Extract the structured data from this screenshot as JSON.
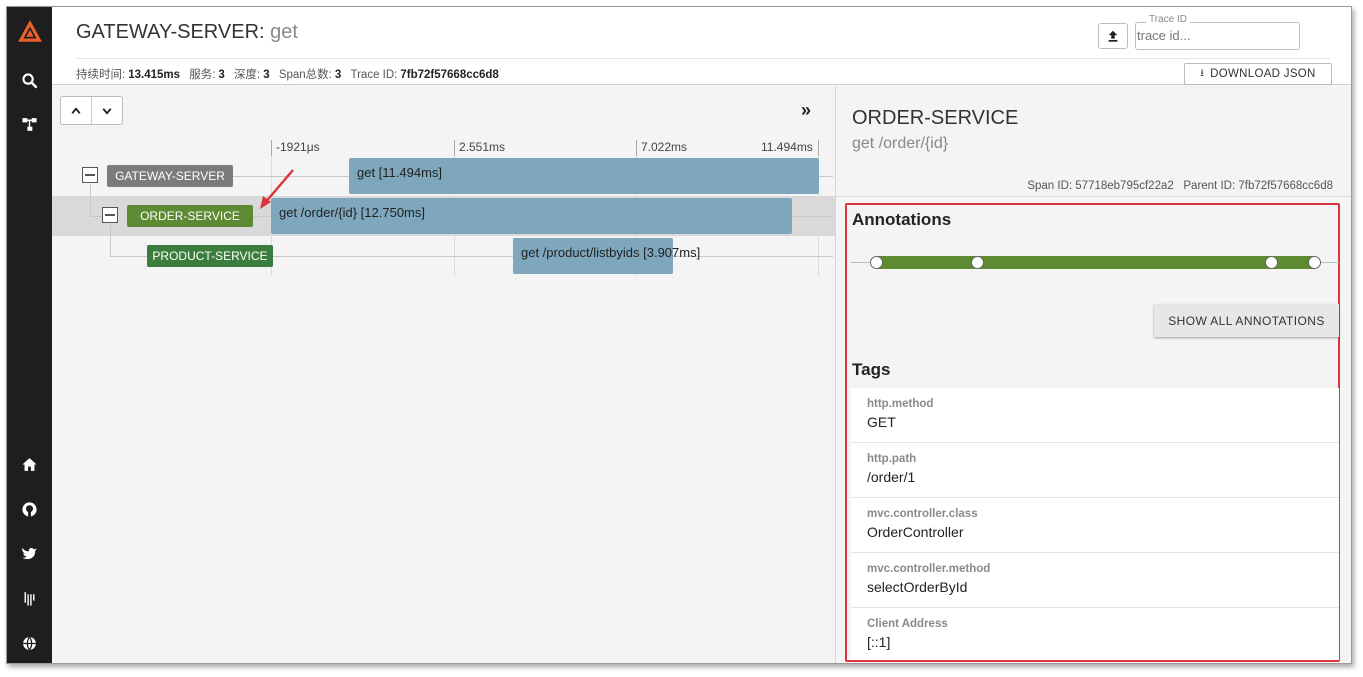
{
  "header": {
    "service": "GATEWAY-SERVER:",
    "span_name": " get",
    "stats": [
      {
        "label": "持续时间:",
        "value": "13.415ms"
      },
      {
        "label": "服务:",
        "value": "3"
      },
      {
        "label": "深度:",
        "value": "3"
      },
      {
        "label": "Span总数:",
        "value": "3"
      },
      {
        "label": "Trace ID:",
        "value": "7fb72f57668cc6d8"
      }
    ],
    "trace_id_label": "Trace ID",
    "trace_id_placeholder": "trace id...",
    "download_label": "DOWNLOAD JSON",
    "upload_icon": "upload-icon",
    "download_icon": "download-icon"
  },
  "sidebar": {
    "top_icons": [
      "logo-icon",
      "search-icon",
      "dependencies-icon"
    ],
    "bottom_icons": [
      "home-icon",
      "github-icon",
      "twitter-icon",
      "gitter-icon",
      "globe-icon"
    ]
  },
  "timeline": {
    "ticks": [
      "-1921μs",
      "2.551ms",
      "7.022ms",
      "11.494ms"
    ],
    "rows": [
      {
        "service": "GATEWAY-SERVER",
        "span": "get [11.494ms]",
        "color": "#7b7b7b"
      },
      {
        "service": "ORDER-SERVICE",
        "span": "get /order/{id} [12.750ms]",
        "color": "#5d8a32"
      },
      {
        "service": "PRODUCT-SERVICE",
        "span": "get /product/listbyids [3.907ms]",
        "color": "#3a7d3d"
      }
    ]
  },
  "detail": {
    "service": "ORDER-SERVICE",
    "span_name": "get /order/{id}",
    "span_id_label": "Span ID:",
    "span_id": "57718eb795cf22a2",
    "parent_id_label": "Parent ID:",
    "parent_id": "7fb72f57668cc6d8",
    "annotations_title": "Annotations",
    "show_all_label": "SHOW ALL ANNOTATIONS",
    "tags_title": "Tags",
    "tags": [
      {
        "key": "http.method",
        "value": "GET"
      },
      {
        "key": "http.path",
        "value": "/order/1"
      },
      {
        "key": "mvc.controller.class",
        "value": "OrderController"
      },
      {
        "key": "mvc.controller.method",
        "value": "selectOrderById"
      },
      {
        "key": "Client Address",
        "value": "[::1]"
      }
    ]
  },
  "colors": {
    "sidebar": "#1e1e1e",
    "logo": "#e8612c",
    "span_bar": "#7ea7bd",
    "annotation_bar": "#5d8a32",
    "highlight_box": "#d9363e"
  }
}
